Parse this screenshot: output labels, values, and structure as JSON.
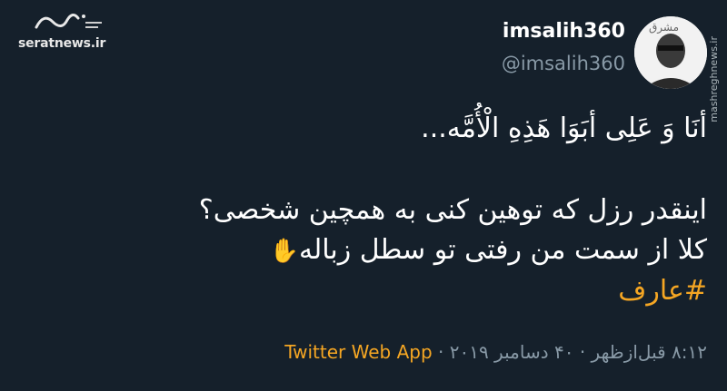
{
  "watermark": {
    "url": "seratnews.ir"
  },
  "header": {
    "display_name": "imsalih360",
    "handle": "@imsalih360"
  },
  "avatar": {
    "side_text": "mashreghnews.ir"
  },
  "tweet": {
    "line1": "أنَا وَ عَلِی أبَوَا هَذِهِ الْأُمَّه...",
    "line2": "اینقدر رزل که توهین کنی به همچین شخصی؟",
    "line3": "کلا از سمت من رفتی تو سطل زباله",
    "hand_emoji": "✋",
    "hashtag": "#عارف"
  },
  "meta": {
    "time": "۸:۱۲ قبل‌ازظهر",
    "separator1": "·",
    "date": "۴۰ دسامبر ۲۰۱۹",
    "separator2": "·",
    "app": "Twitter Web App"
  },
  "colors": {
    "background": "#15202b",
    "accent": "#f5a623",
    "secondary_text": "#8899a6"
  }
}
